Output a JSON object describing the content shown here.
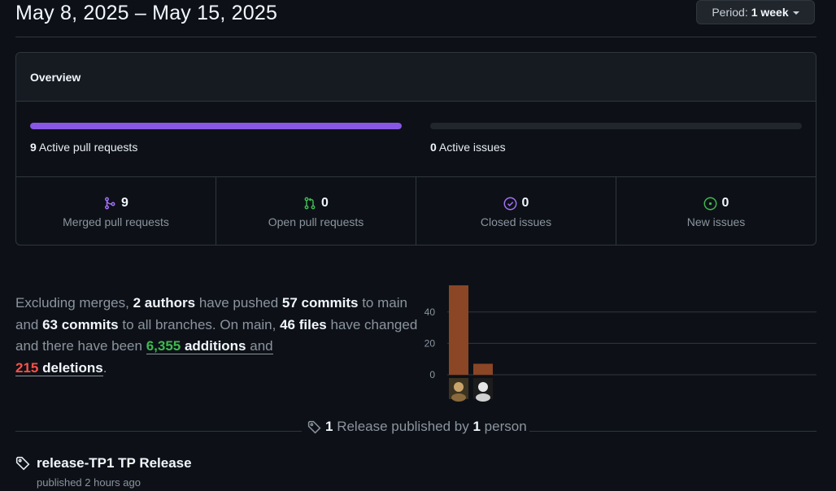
{
  "header": {
    "date_range": "May 8, 2025 – May 15, 2025",
    "period_label": "Period:",
    "period_value": "1 week"
  },
  "overview": {
    "title": "Overview",
    "pull_requests": {
      "count": "9",
      "label": "Active pull requests",
      "fill_fraction": 1.0,
      "color": "#8957e5"
    },
    "issues": {
      "count": "0",
      "label": "Active issues",
      "fill_fraction": 0.0
    },
    "stats": [
      {
        "icon": "merge-icon",
        "value": "9",
        "label": "Merged pull requests",
        "color": "#a371f7"
      },
      {
        "icon": "pull-request-icon",
        "value": "0",
        "label": "Open pull requests",
        "color": "#3fb950"
      },
      {
        "icon": "check-circle-icon",
        "value": "0",
        "label": "Closed issues",
        "color": "#a371f7"
      },
      {
        "icon": "issue-open-icon",
        "value": "0",
        "label": "New issues",
        "color": "#3fb950"
      }
    ]
  },
  "summary": {
    "t1": "Excluding merges, ",
    "authors": "2 authors",
    "t2": " have pushed ",
    "commits_main": "57 commits",
    "t3": " to main and ",
    "commits_all": "63 commits",
    "t4": " to all branches. On main, ",
    "files": "46 files",
    "t5": " have changed and there have been ",
    "additions_num": "6,355",
    "additions_word": " additions",
    "t6": " and",
    "deletions_num": "215",
    "deletions_word": " deletions",
    "t7": "."
  },
  "chart_data": {
    "type": "bar",
    "categories": [
      "author-1",
      "author-2"
    ],
    "values": [
      57,
      7
    ],
    "yticks": [
      0,
      20,
      40
    ],
    "ylim": [
      0,
      57
    ],
    "bar_color": "#8b4625"
  },
  "releases": {
    "count": "1",
    "mid": " Release published by ",
    "people": "1",
    "tail": " person",
    "item_title": "release-TP1 TP Release",
    "item_sub": "published 2 hours ago"
  }
}
